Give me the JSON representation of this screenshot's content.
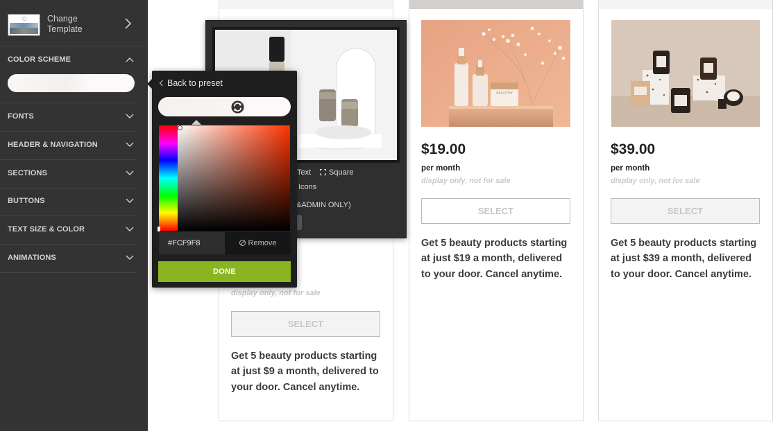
{
  "sidebar": {
    "template": {
      "label_line1": "Change",
      "label_line2": "Template"
    },
    "sections": [
      {
        "label": "COLOR SCHEME",
        "expanded": true
      },
      {
        "label": "FONTS"
      },
      {
        "label": "HEADER & NAVIGATION"
      },
      {
        "label": "SECTIONS"
      },
      {
        "label": "BUTTONS"
      },
      {
        "label": "TEXT SIZE & COLOR"
      },
      {
        "label": "ANIMATIONS"
      }
    ],
    "color_scheme_value": "#FCF9F8"
  },
  "color_picker": {
    "back_label": "Back to preset",
    "hex_value": "#FCF9F8",
    "remove_label": "Remove",
    "done_label": "DONE",
    "hue_color": "#FF3300"
  },
  "image_popup": {
    "options": {
      "text": "Text",
      "square": "Square",
      "icons": "Icons",
      "admin": "&ADMIN ONLY)"
    }
  },
  "cards": [
    {
      "disclaimer": "display only, not for sale",
      "select_label": "SELECT",
      "description": "Get 5 beauty products starting at just $9 a month, delivered to your door. Cancel anytime."
    },
    {
      "price": "$19.00",
      "per": "per month",
      "disclaimer": "display only, not for sale",
      "select_label": "SELECT",
      "description": "Get 5 beauty products starting at just $19 a month, delivered to your door. Cancel anytime.",
      "jar_label": "BEAUTHY"
    },
    {
      "price": "$39.00",
      "per": "per month",
      "disclaimer": "display only, not for sale",
      "select_label": "SELECT",
      "description": "Get 5 beauty products starting at just $39 a month, delivered to your door. Cancel anytime."
    }
  ],
  "colors": {
    "sidebar_bg": "#333333",
    "done_button": "#8AB520",
    "popup_bg": "#1F1F1F"
  }
}
